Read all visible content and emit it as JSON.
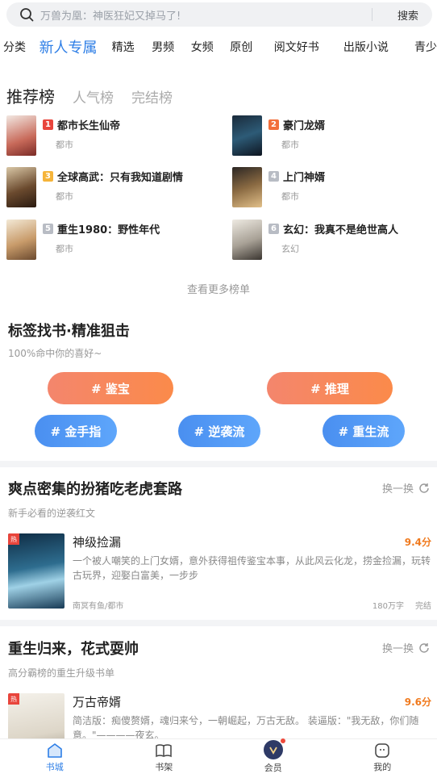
{
  "search": {
    "placeholder": "万兽为凰：神医狂妃又掉马了!",
    "button": "搜索"
  },
  "tabs": [
    "分类",
    "新人专属",
    "精选",
    "男频",
    "女频",
    "原创",
    "阅文好书",
    "出版小说",
    "青少"
  ],
  "ranking": {
    "tabs": [
      "推荐榜",
      "人气榜",
      "完结榜"
    ],
    "items": [
      {
        "num": "1",
        "title": "都市长生仙帝",
        "tag": "都市"
      },
      {
        "num": "2",
        "title": "豪门龙婿",
        "tag": "都市"
      },
      {
        "num": "3",
        "title": "全球高武：只有我知道剧情",
        "tag": "都市"
      },
      {
        "num": "4",
        "title": "上门神婿",
        "tag": "都市"
      },
      {
        "num": "5",
        "title": "重生1980：野性年代",
        "tag": "都市"
      },
      {
        "num": "6",
        "title": "玄幻：我真不是绝世高人",
        "tag": "玄幻"
      }
    ],
    "more": "查看更多榜单"
  },
  "tag_section": {
    "title": "标签找书·精准狙击",
    "subtitle": "100%命中你的喜好~",
    "tags": [
      "# 鉴宝",
      "# 推理",
      "# 金手指",
      "# 逆袭流",
      "# 重生流"
    ]
  },
  "section1": {
    "title": "爽点密集的扮猪吃老虎套路",
    "subtitle": "新手必看的逆袭红文",
    "refresh": "换一换",
    "book": {
      "badge": "热",
      "title": "神级捡漏",
      "score": "9.4分",
      "desc": "一个被人嘲笑的上门女婿，意外获得祖传鉴宝本事，从此风云化龙，捞金捡漏，玩转古玩界，迎娶白富美，一步步",
      "author": "南冥有鱼/都市",
      "words": "180万字",
      "status": "完结"
    }
  },
  "section2": {
    "title": "重生归来，花式耍帅",
    "subtitle": "高分霸榜的重生升级书单",
    "refresh": "换一换",
    "book": {
      "badge": "热",
      "title": "万古帝婿",
      "score": "9.6分",
      "desc": "简洁版：痴傻赘婿，魂归来兮，一朝崛起，万古无敌。 装逼版：\"我无敌，你们随意。\"————夜玄。"
    }
  },
  "nav": [
    "书城",
    "书架",
    "会员",
    "我的"
  ],
  "colors": {
    "accent": "#2d7ee6",
    "score": "#f07a1e",
    "rank1": "#e8453c",
    "rank2": "#f26f3b",
    "rank3": "#f5b43a",
    "rank_other": "#b8bcc4"
  }
}
